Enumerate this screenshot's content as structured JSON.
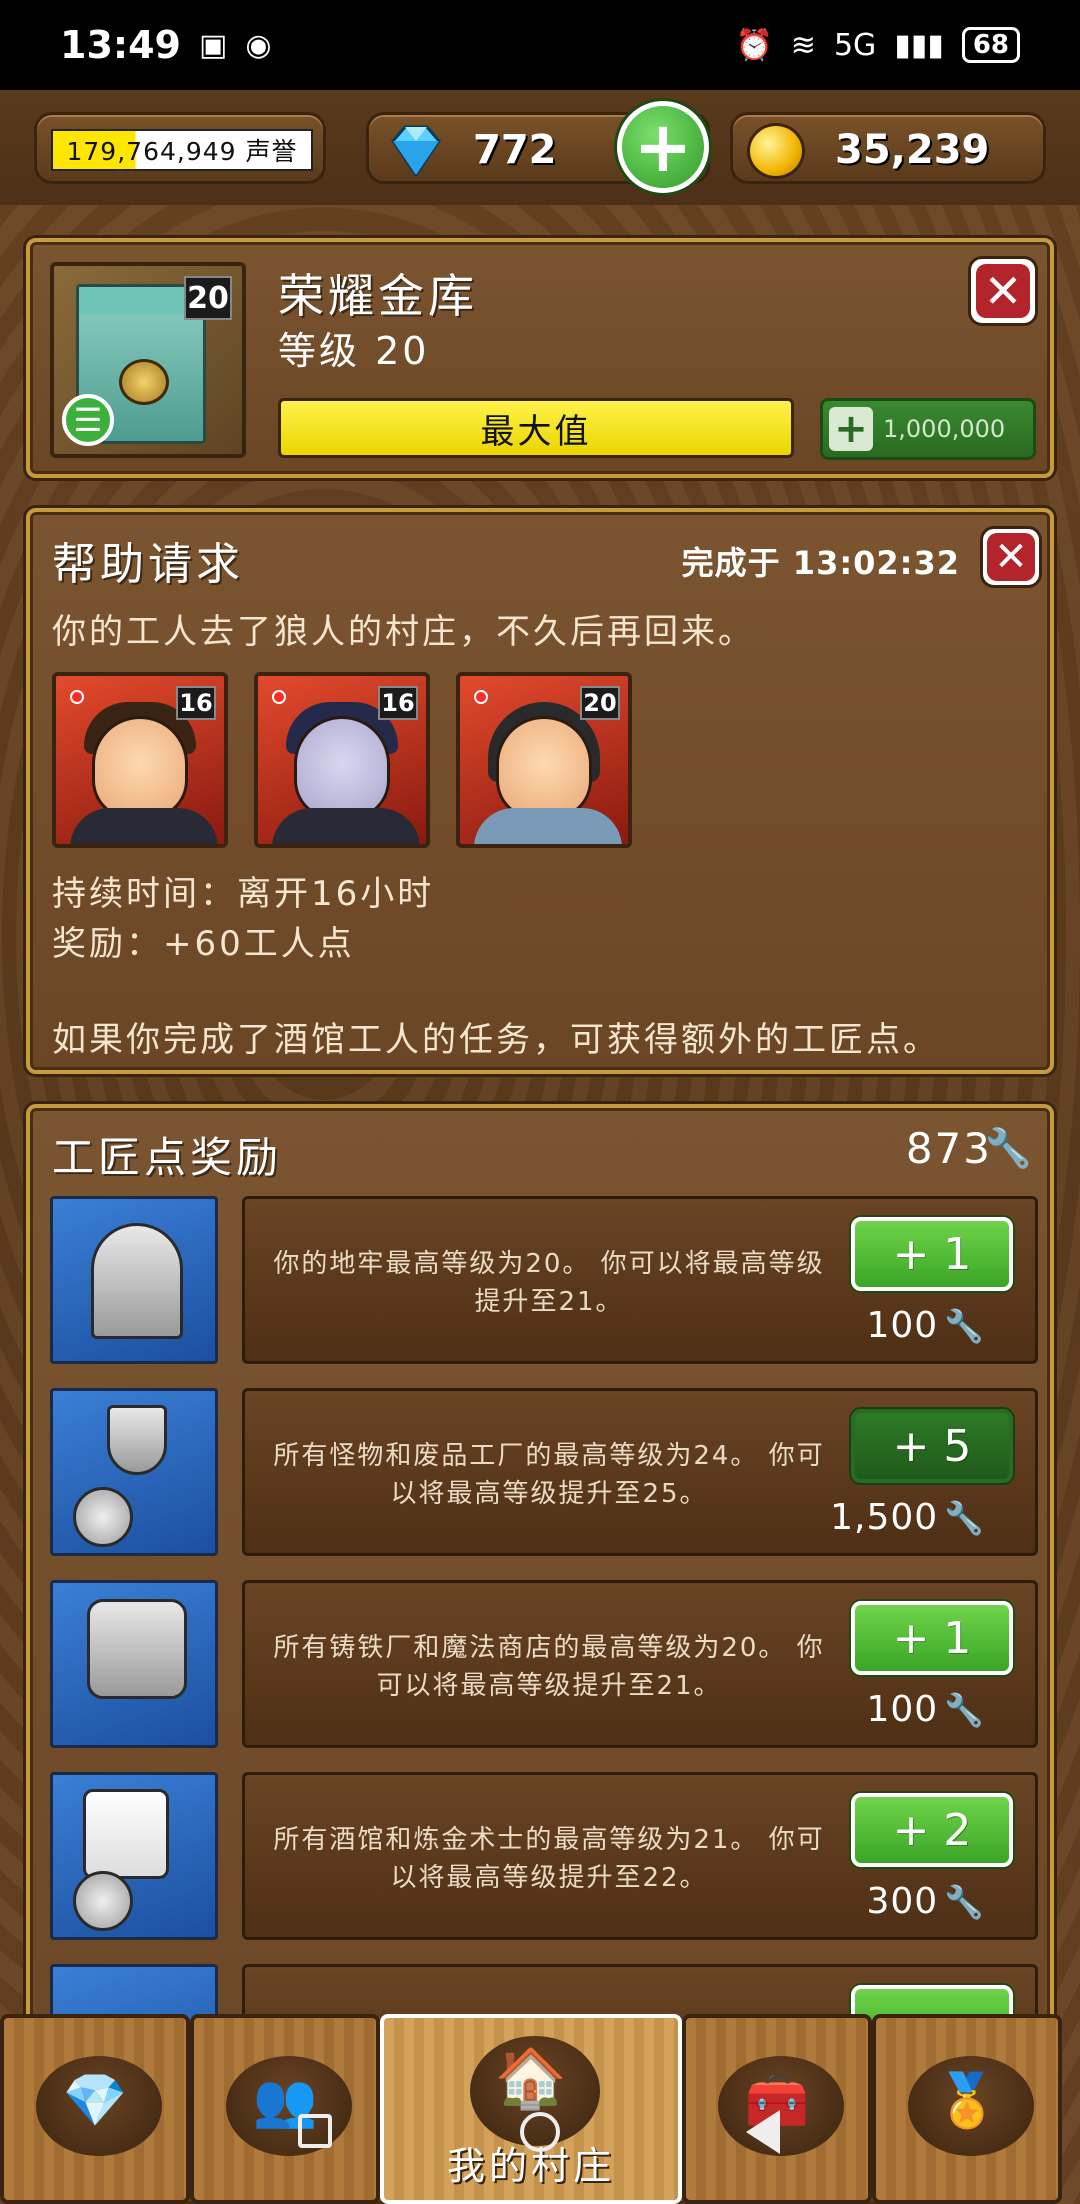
{
  "status_bar": {
    "time": "13:49",
    "battery": "68",
    "network": "5G"
  },
  "resources": {
    "fame_value": "179,764,949 声誉",
    "gems": "772",
    "coins": "35,239"
  },
  "vault": {
    "title": "荣耀金库",
    "level_text": "等级 20",
    "level_badge": "20",
    "max_label": "最大值",
    "upgrade_cost": "1,000,000"
  },
  "help_request": {
    "title": "帮助请求",
    "done_at": "完成于 13:02:32",
    "description": "你的工人去了狼人的村庄，不久后再回来。",
    "workers": [
      {
        "level": "16"
      },
      {
        "level": "16"
      },
      {
        "level": "20"
      }
    ],
    "duration": "持续时间：离开16小时",
    "reward": "奖励：+60工人点",
    "note": "如果你完成了酒馆工人的任务，可获得额外的工匠点。"
  },
  "craft_bonus": {
    "title": "工匠点奖励",
    "total": "873",
    "rows": [
      {
        "desc": "你的地牢最高等级为20。 你可以将最高等级提升至21。",
        "button": "+ 1",
        "cost": "100"
      },
      {
        "desc": "所有怪物和废品工厂的最高等级为24。 你可以将最高等级提升至25。",
        "button": "+ 5",
        "cost": "1,500"
      },
      {
        "desc": "所有铸铁厂和魔法商店的最高等级为20。 你可以将最高等级提升至21。",
        "button": "+ 1",
        "cost": "100"
      },
      {
        "desc": "所有酒馆和炼金术士的最高等级为21。 你可以将最高等级提升至22。",
        "button": "+ 2",
        "cost": "300"
      }
    ]
  },
  "bottom_nav": {
    "active_label": "我的村庄",
    "tabs": [
      "gems-shop",
      "workers",
      "my-village",
      "treasure",
      "achievements"
    ]
  },
  "colors": {
    "accent_green": "#3aa626",
    "wood_dark": "#5a3a1c",
    "gold_border": "#c79a3c",
    "close_red": "#b3242b"
  }
}
